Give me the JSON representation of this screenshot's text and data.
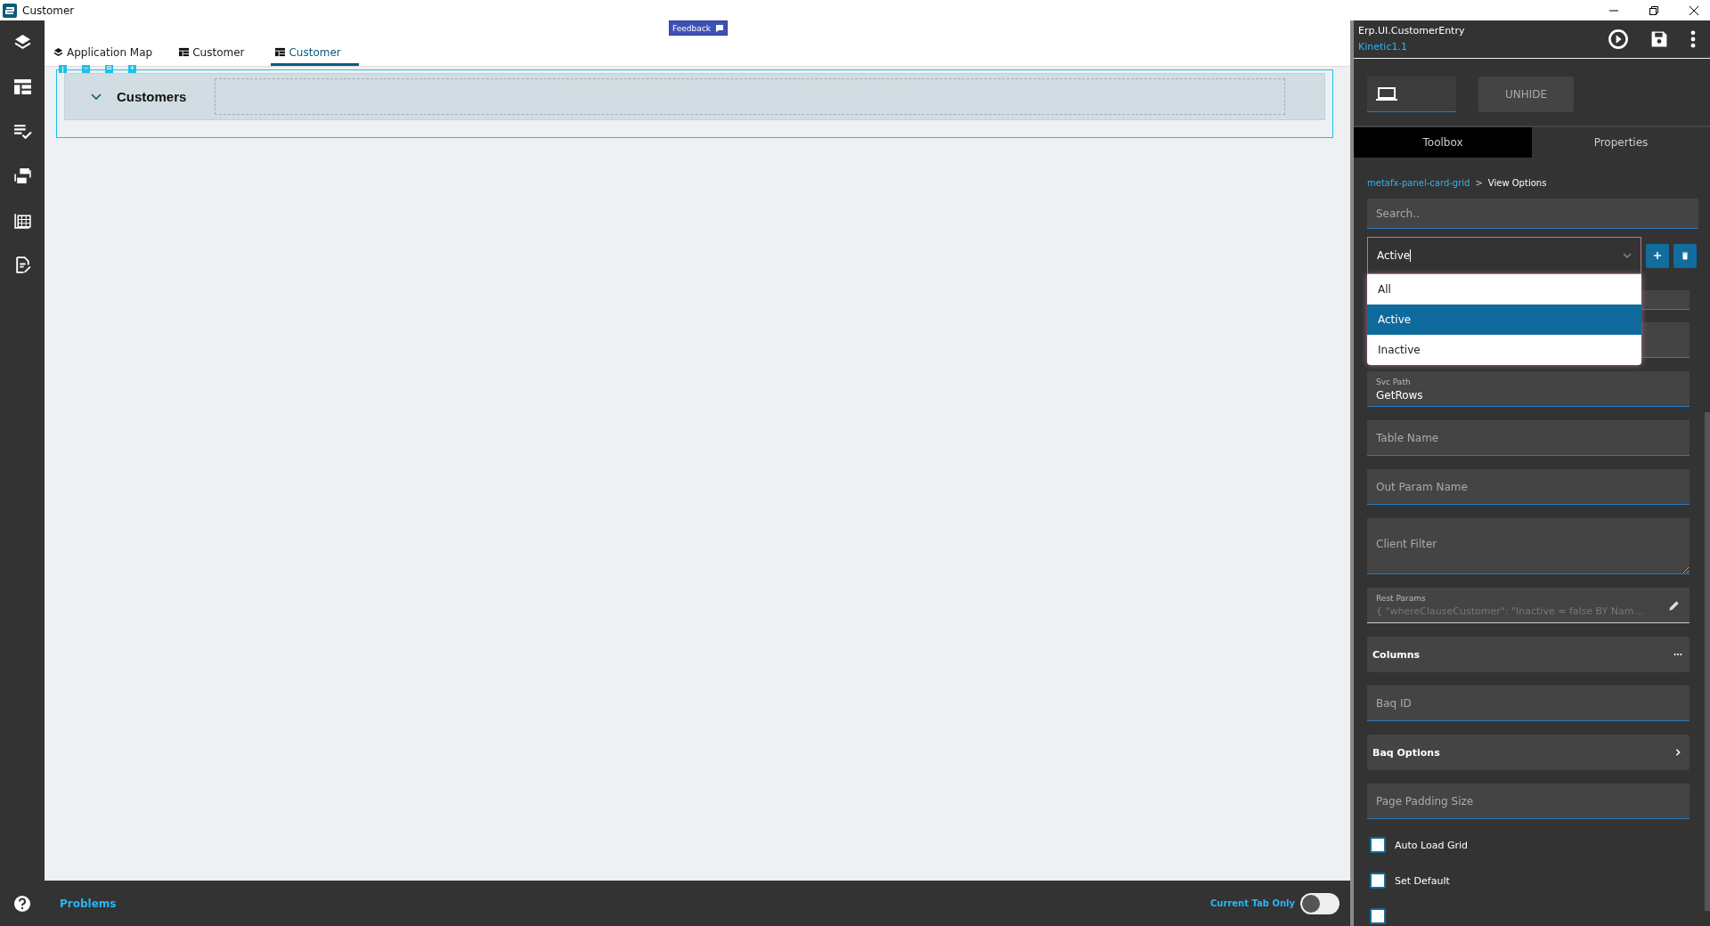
{
  "window": {
    "title": "Customer"
  },
  "tabs": [
    {
      "label": "Application Map",
      "kind": "map",
      "selected": false
    },
    {
      "label": "Customer",
      "kind": "page",
      "selected": false
    },
    {
      "label": "Customer",
      "kind": "page",
      "selected": true
    }
  ],
  "feedback": {
    "label": "Feedback"
  },
  "panel": {
    "title": "Customers",
    "expanded": true
  },
  "bottom_bar": {
    "problems": "Problems",
    "toggle": {
      "label": "Current Tab Only",
      "on": false
    }
  },
  "designer": {
    "name": "Erp.UI.CustomerEntry",
    "version": "Kinetic1.1",
    "unhide": "UNHIDE",
    "tabs": [
      {
        "label": "Toolbox",
        "selected": true
      },
      {
        "label": "Properties",
        "selected": false
      }
    ],
    "breadcrumb": {
      "link": "metafx-panel-card-grid",
      "separator": ">",
      "current": "View Options"
    },
    "search": {
      "placeholder": "Search.."
    },
    "view_select": {
      "value": "Active",
      "options": [
        {
          "label": "All",
          "selected": false
        },
        {
          "label": "Active",
          "selected": true
        },
        {
          "label": "Inactive",
          "selected": false
        }
      ]
    },
    "fields": [
      {
        "kind": "covered"
      },
      {
        "kind": "covered"
      },
      {
        "kind": "text",
        "label": "Svc Path",
        "value": "GetRows"
      },
      {
        "kind": "text",
        "placeholder": "Table Name"
      },
      {
        "kind": "text",
        "placeholder": "Out Param Name"
      },
      {
        "kind": "textarea",
        "placeholder": "Client Filter"
      },
      {
        "kind": "editor",
        "label": "Rest Params",
        "value": "{  \"whereClauseCustomer\": \"Inactive = false BY Nam…"
      },
      {
        "kind": "menusection",
        "label": "Columns"
      },
      {
        "kind": "text",
        "placeholder": "Baq ID"
      },
      {
        "kind": "navsection",
        "label": "Baq Options"
      },
      {
        "kind": "text",
        "placeholder": "Page Padding Size"
      },
      {
        "kind": "checkbox",
        "label": "Auto Load Grid",
        "checked": false
      },
      {
        "kind": "checkbox",
        "label": "Set Default",
        "checked": false
      },
      {
        "kind": "checkbox",
        "checked": false
      }
    ]
  }
}
